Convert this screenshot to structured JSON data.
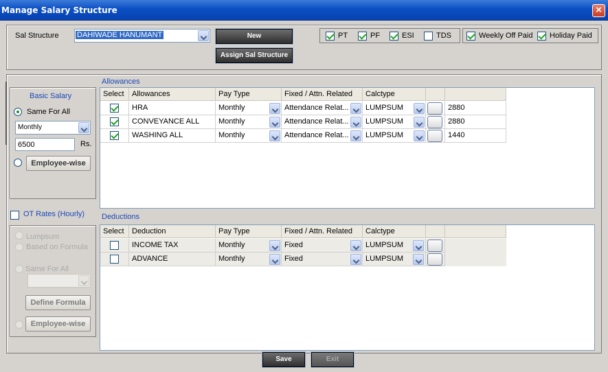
{
  "window": {
    "title": "Manage Salary Structure",
    "close": "×"
  },
  "top": {
    "sal_structure_label": "Sal Structure",
    "sal_structure_value": "DAHIWADE HANUMANT",
    "new_label": "New",
    "assign_label": "Assign Sal Structure",
    "options": [
      {
        "label": "PT",
        "checked": true
      },
      {
        "label": "PF",
        "checked": true
      },
      {
        "label": "ESI",
        "checked": true
      },
      {
        "label": "TDS",
        "checked": false
      }
    ],
    "weekly_off_paid": {
      "label": "Weekly Off Paid",
      "checked": true
    },
    "holiday_paid": {
      "label": "Holiday Paid",
      "checked": true
    }
  },
  "basic": {
    "title": "Basic Salary",
    "same_for_all": "Same For All",
    "frequency": "Monthly",
    "amount": "6500",
    "unit": "Rs.",
    "employee_wise": "Employee-wise"
  },
  "ot": {
    "label": "OT Rates (Hourly)",
    "checked": false,
    "lumpsum": "Lumpsum",
    "based_on_formula": "Based on Formula",
    "same_for_all": "Same For All",
    "define_formula": "Define Formula",
    "employee_wise": "Employee-wise"
  },
  "allowances": {
    "title": "Allowances",
    "headers": [
      "Select",
      "Allowances",
      "Pay Type",
      "Fixed / Attn. Related",
      "Calctype",
      ""
    ],
    "rows": [
      {
        "checked": true,
        "name": "HRA",
        "pay_type": "Monthly",
        "fixed": "Attendance Relat...",
        "calc": "LUMPSUM",
        "amount": "2880"
      },
      {
        "checked": true,
        "name": "CONVEYANCE ALL",
        "pay_type": "Monthly",
        "fixed": "Attendance Relat...",
        "calc": "LUMPSUM",
        "amount": "2880"
      },
      {
        "checked": true,
        "name": "WASHING ALL",
        "pay_type": "Monthly",
        "fixed": "Attendance Relat...",
        "calc": "LUMPSUM",
        "amount": "1440"
      }
    ]
  },
  "deductions": {
    "title": "Deductions",
    "headers": [
      "Select",
      "Deduction",
      "Pay Type",
      "Fixed / Attn. Related",
      "Calctype",
      ""
    ],
    "rows": [
      {
        "checked": false,
        "name": "INCOME TAX",
        "pay_type": "Monthly",
        "fixed": "Fixed",
        "calc": "LUMPSUM"
      },
      {
        "checked": false,
        "name": "ADVANCE",
        "pay_type": "Monthly",
        "fixed": "Fixed",
        "calc": "LUMPSUM"
      }
    ]
  },
  "footer": {
    "save": "Save",
    "exit": "Exit"
  },
  "colors": {
    "title_bar": "#0a4fc4",
    "section_text": "#1a47b8",
    "selection": "#316ac5"
  }
}
